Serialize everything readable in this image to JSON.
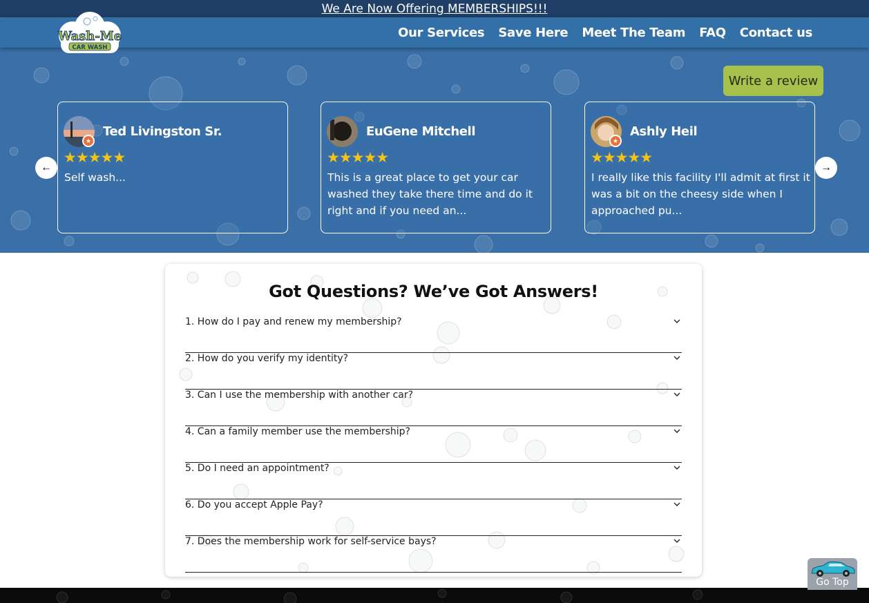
{
  "announcement": {
    "text": "We Are Now Offering MEMBERSHIPS!!!"
  },
  "brand": {
    "logo_line1": "Wash-Me",
    "logo_line2": "CAR WASH"
  },
  "nav": {
    "items": [
      "Our Services",
      "Save Here",
      "Meet The Team",
      "FAQ",
      "Contact us"
    ]
  },
  "reviews": {
    "write_label": "Write a review",
    "items": [
      {
        "name": "Ted Livingston Sr.",
        "stars": "★★★★★",
        "text": "Self wash..."
      },
      {
        "name": "EuGene Mitchell",
        "stars": "★★★★★",
        "text": "This is a great place to get your car washed they take there time and do it right and if you need an..."
      },
      {
        "name": "Ashly Heil",
        "stars": "★★★★★",
        "text": "I really like this facility I'll admit at first it was a bit on the cheesy side when I approached pu..."
      }
    ],
    "prev_icon": "←",
    "next_icon": "→"
  },
  "faq": {
    "title": "Got Questions? We’ve Got Answers!",
    "items": [
      "1. How do I pay and renew my membership?",
      "2. How do you verify my identity?",
      "3. Can I use the membership with another car?",
      "4. Can a family member use the membership?",
      "5. Do I need an appointment?",
      "6. Do you accept Apple Pay?",
      "7. Does the membership work for self-service bays?"
    ]
  },
  "go_top": {
    "label": "Go Top"
  },
  "colors": {
    "header": "#3470a8",
    "announce": "#1f3f66",
    "accent_button": "#a7c14d",
    "stars": "#f3c316"
  }
}
